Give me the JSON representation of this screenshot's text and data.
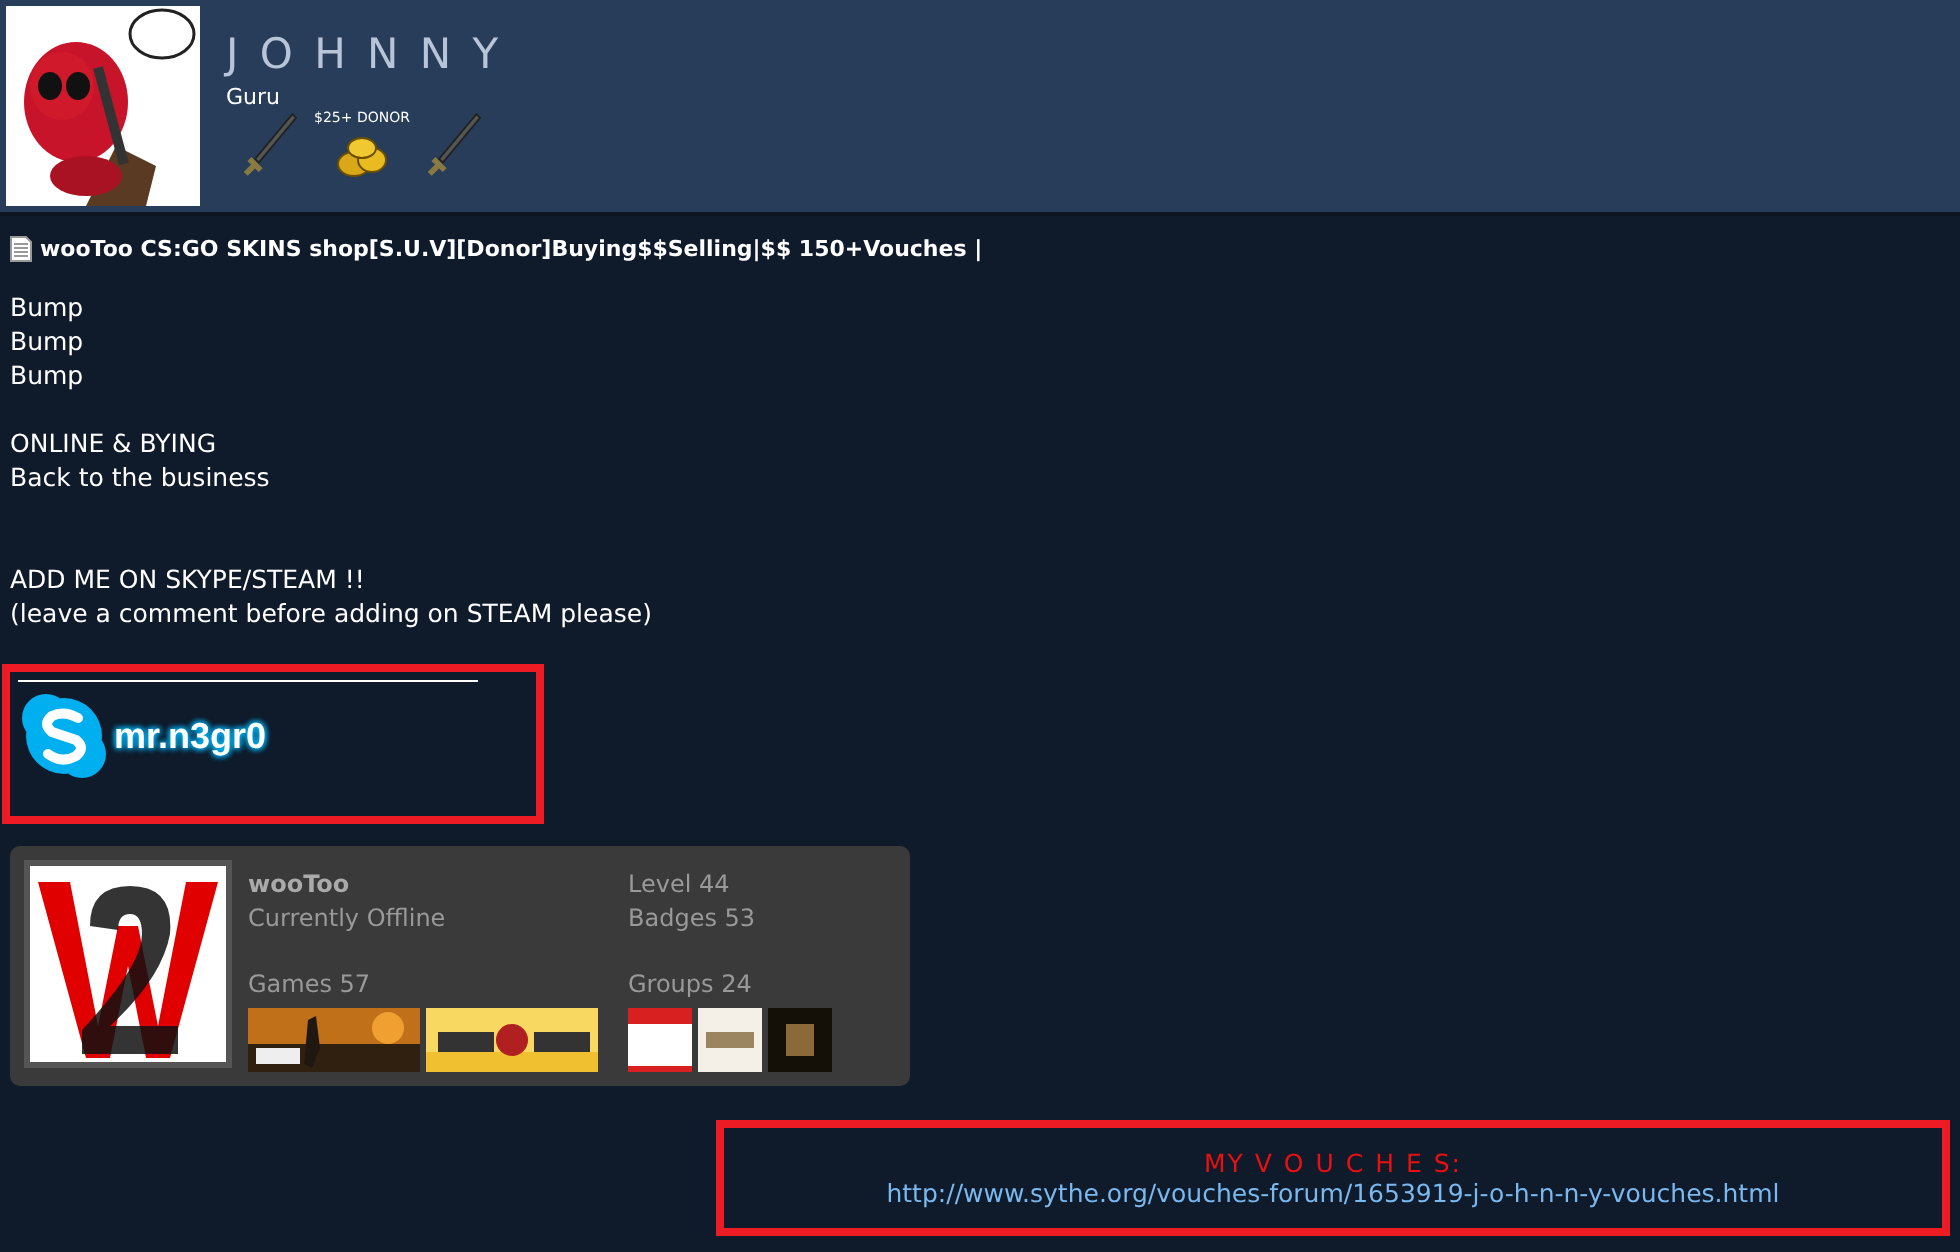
{
  "profile": {
    "username": "J O H N N Y",
    "rank": "Guru",
    "badge_label": "$25+ DONOR"
  },
  "thread": {
    "title": "wooToo CS:GO SKINS shop[S.U.V][Donor]Buying$$Selling|$$ 150+Vouches |",
    "paragraphs": [
      [
        "Bump",
        "Bump",
        "Bump"
      ],
      [
        "ONLINE & BYING",
        "Back to the business"
      ],
      [
        "ADD ME ON SKYPE/STEAM !!",
        "(leave a comment before adding on STEAM please)"
      ]
    ]
  },
  "skype": {
    "handle": "mr.n3gr0"
  },
  "steam_card": {
    "name": "wooToo",
    "status": "Currently Offline",
    "level": "Level 44",
    "badges": "Badges 53",
    "games": "Games 57",
    "groups": "Groups 24"
  },
  "vouches": {
    "heading": "MY V O U C H E S:",
    "link": "http://www.sythe.org/vouches-forum/1653919-j-o-h-n-n-y-vouches.html"
  }
}
